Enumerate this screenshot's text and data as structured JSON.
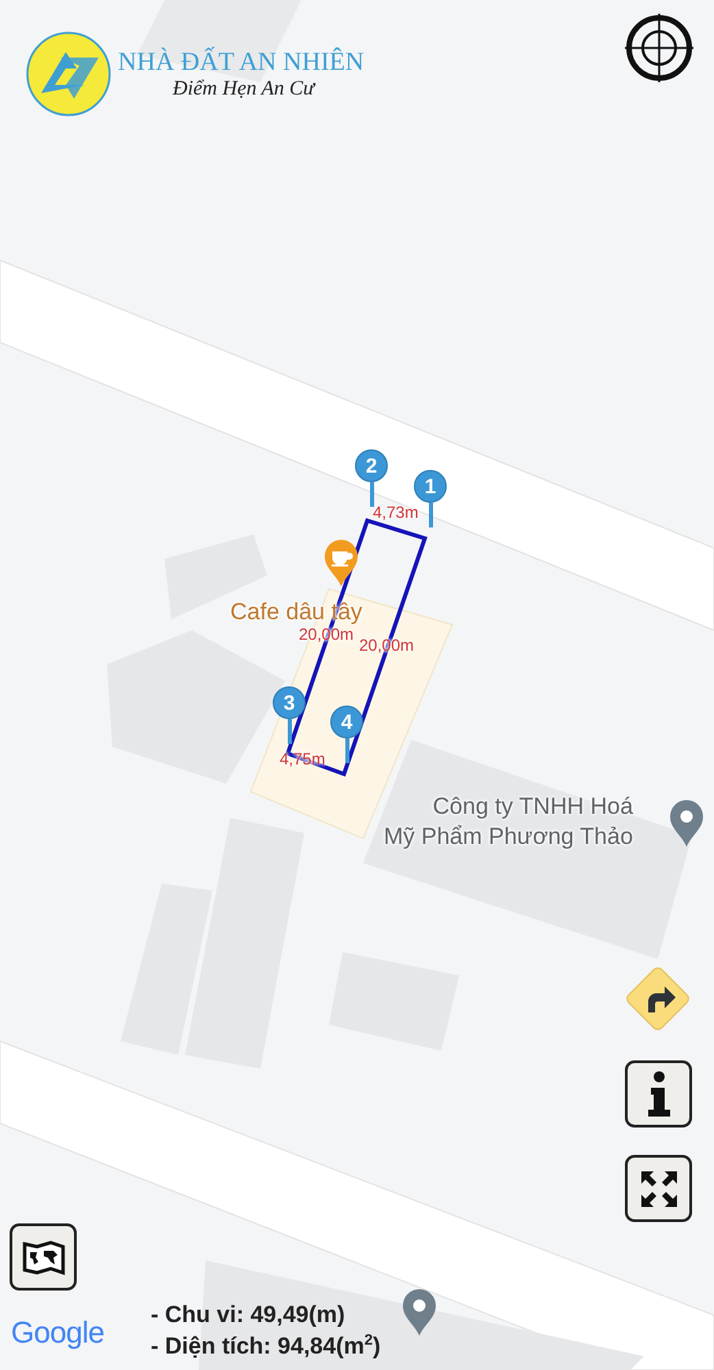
{
  "logo": {
    "title": "NHÀ ĐẤT AN NHIÊN",
    "subtitle": "Điểm Hẹn An Cư"
  },
  "map": {
    "pois": [
      {
        "kind": "cafe",
        "label": "Cafe dâu tây"
      },
      {
        "kind": "place",
        "label": "Công ty TNHH Hoá\nMỹ Phẩm Phương Thảo"
      }
    ],
    "markers": [
      "1",
      "2",
      "3",
      "4"
    ],
    "edge_labels": [
      "4,73m",
      "20,00m",
      "20,00m",
      "4,75m"
    ],
    "attribution": "Google"
  },
  "summary": [
    "- Chu vi: 49,49(m)",
    "- Diện tích: 94,84(m$^{2}$)"
  ]
}
